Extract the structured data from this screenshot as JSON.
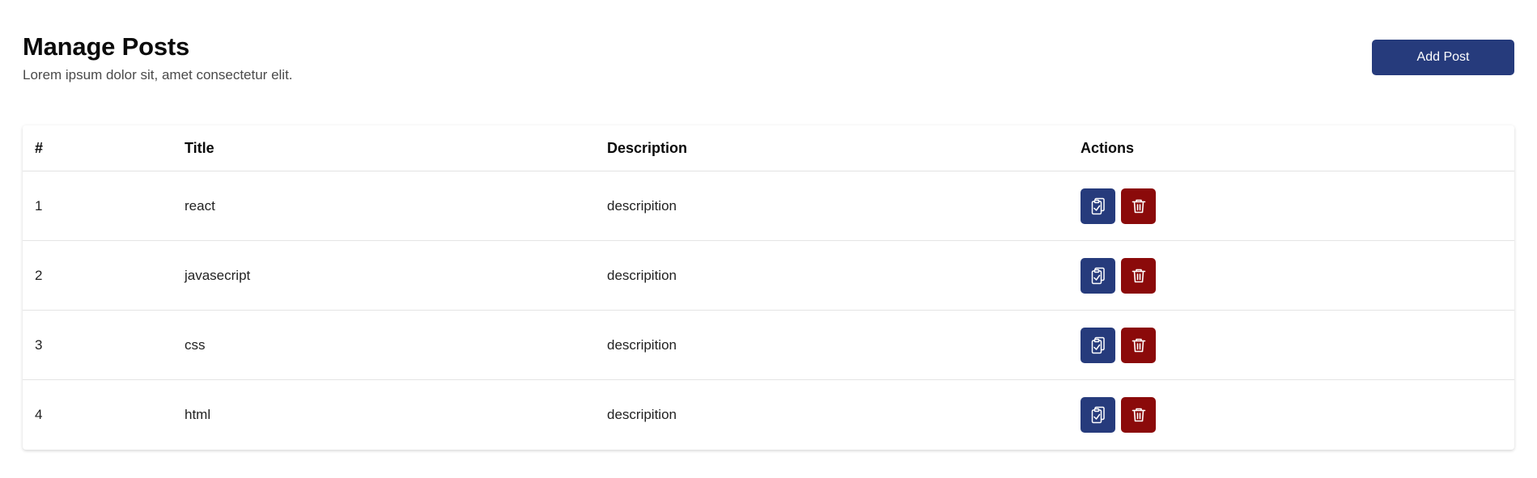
{
  "header": {
    "title": "Manage Posts",
    "subtitle": "Lorem ipsum dolor sit, amet consectetur elit.",
    "add_button_label": "Add Post"
  },
  "table": {
    "columns": [
      "#",
      "Title",
      "Description",
      "Actions"
    ],
    "rows": [
      {
        "id": "1",
        "title": "react",
        "description": "descripition"
      },
      {
        "id": "2",
        "title": "javasecript",
        "description": "descripition"
      },
      {
        "id": "3",
        "title": "css",
        "description": "descripition"
      },
      {
        "id": "4",
        "title": "html",
        "description": "descripition"
      }
    ]
  },
  "icons": {
    "edit": "clipboard-check-icon",
    "delete": "trash-icon"
  },
  "colors": {
    "primary": "#263b7c",
    "danger": "#8b0a0a",
    "text": "#0b0b0b",
    "muted": "#4a4a4a"
  }
}
